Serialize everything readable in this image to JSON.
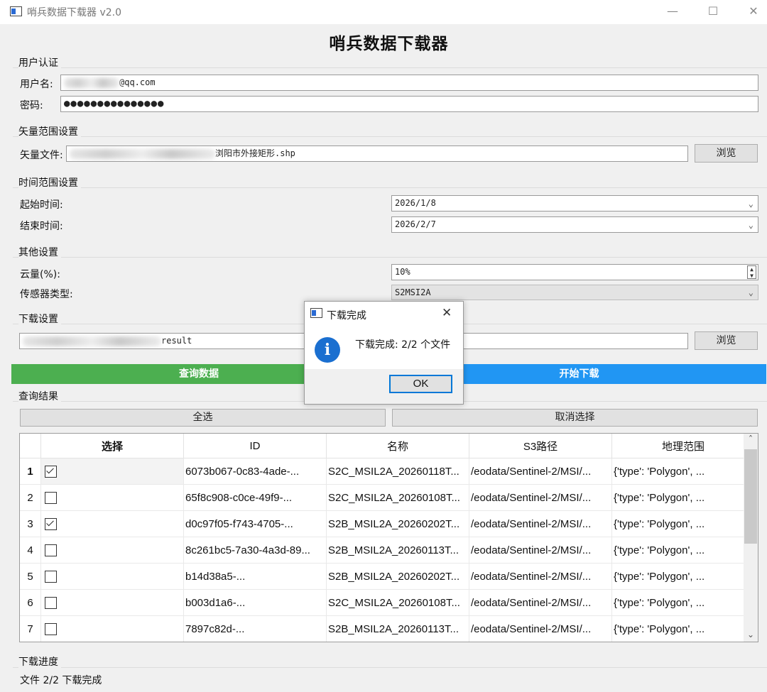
{
  "window": {
    "title": "哨兵数据下载器 v2.0",
    "minimize_glyph": "—",
    "maximize_glyph": "☐",
    "close_glyph": "✕",
    "app_icon": "window-icon"
  },
  "heading": "哨兵数据下载器",
  "auth": {
    "title": "用户认证",
    "username_label": "用户名:",
    "username_value": "@qq.com",
    "password_label": "密码:",
    "password_value": "●●●●●●●●●●●●●●●"
  },
  "vector": {
    "title": "矢量范围设置",
    "file_label": "矢量文件:",
    "file_value": "浏阳市外接矩形.shp",
    "browse": "浏览"
  },
  "time": {
    "title": "时间范围设置",
    "start_label": "起始时间:",
    "start_value": "2026/1/8",
    "end_label": "结束时间:",
    "end_value": "2026/2/7"
  },
  "other": {
    "title": "其他设置",
    "cloud_label": "云量(%):",
    "cloud_value": "10%",
    "sensor_label": "传感器类型:",
    "sensor_value": "S2MSI2A"
  },
  "download": {
    "title": "下载设置",
    "dir_value": "result",
    "browse": "浏览"
  },
  "actions": {
    "query": "查询数据",
    "start": "开始下载",
    "query_color": "#4caf50",
    "start_color": "#2196f3"
  },
  "results": {
    "title": "查询结果",
    "select_all": "全选",
    "deselect": "取消选择",
    "headers": [
      "选择",
      "ID",
      "名称",
      "S3路径",
      "地理范围"
    ],
    "rows": [
      {
        "n": "1",
        "checked": true,
        "id": "6073b067-0c83-4ade-...",
        "name": "S2C_MSIL2A_20260118T...",
        "path": "/eodata/Sentinel-2/MSI/...",
        "geo": "{'type': 'Polygon', ..."
      },
      {
        "n": "2",
        "checked": false,
        "id": "65f8c908-c0ce-49f9-...",
        "name": "S2C_MSIL2A_20260108T...",
        "path": "/eodata/Sentinel-2/MSI/...",
        "geo": "{'type': 'Polygon', ..."
      },
      {
        "n": "3",
        "checked": true,
        "id": "d0c97f05-f743-4705-...",
        "name": "S2B_MSIL2A_20260202T...",
        "path": "/eodata/Sentinel-2/MSI/...",
        "geo": "{'type': 'Polygon', ..."
      },
      {
        "n": "4",
        "checked": false,
        "id": "8c261bc5-7a30-4a3d-89...",
        "name": "S2B_MSIL2A_20260113T...",
        "path": "/eodata/Sentinel-2/MSI/...",
        "geo": "{'type': 'Polygon', ..."
      },
      {
        "n": "5",
        "checked": false,
        "id": "b14d38a5-...",
        "name": "S2B_MSIL2A_20260202T...",
        "path": "/eodata/Sentinel-2/MSI/...",
        "geo": "{'type': 'Polygon', ..."
      },
      {
        "n": "6",
        "checked": false,
        "id": "b003d1a6-...",
        "name": "S2C_MSIL2A_20260108T...",
        "path": "/eodata/Sentinel-2/MSI/...",
        "geo": "{'type': 'Polygon', ..."
      },
      {
        "n": "7",
        "checked": false,
        "id": "7897c82d-...",
        "name": "S2B_MSIL2A_20260113T...",
        "path": "/eodata/Sentinel-2/MSI/...",
        "geo": "{'type': 'Polygon', ..."
      }
    ]
  },
  "progress": {
    "title": "下载进度",
    "status": "文件 2/2 下载完成"
  },
  "dialog": {
    "title": "下载完成",
    "message": "下载完成: 2/2 个文件",
    "ok": "OK",
    "close_glyph": "✕",
    "icon_glyph": "i"
  }
}
